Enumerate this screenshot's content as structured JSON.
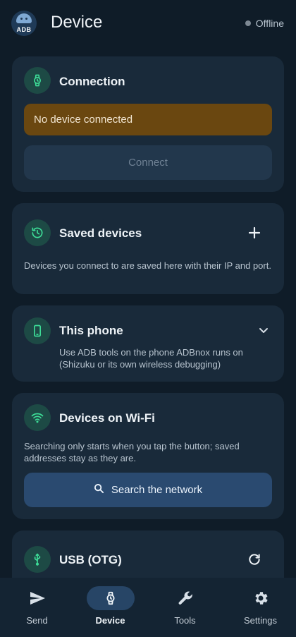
{
  "header": {
    "logo_text": "ADB",
    "title": "Device",
    "status": "Offline"
  },
  "connection": {
    "title": "Connection",
    "alert": "No device connected",
    "connect_label": "Connect"
  },
  "saved": {
    "title": "Saved devices",
    "description": "Devices you connect to are saved here with their IP and port."
  },
  "this_phone": {
    "title": "This phone",
    "description": "Use ADB tools on the phone ADBnox runs on (Shizuku or its own wireless debugging)"
  },
  "wifi": {
    "title": "Devices on Wi-Fi",
    "description": "Searching only starts when you tap the button; saved addresses stay as they are.",
    "search_label": "Search the network"
  },
  "usb": {
    "title": "USB (OTG)"
  },
  "nav": {
    "items": [
      {
        "label": "Send",
        "icon": "send-icon"
      },
      {
        "label": "Device",
        "icon": "watch-icon"
      },
      {
        "label": "Tools",
        "icon": "wrench-icon"
      },
      {
        "label": "Settings",
        "icon": "gear-icon"
      }
    ],
    "active": "Device"
  },
  "colors": {
    "background": "#0f1c28",
    "card": "#192a3a",
    "accent_icon": "#3ddc97",
    "warning": "#6a4710",
    "primary_button": "#2a4a70"
  }
}
